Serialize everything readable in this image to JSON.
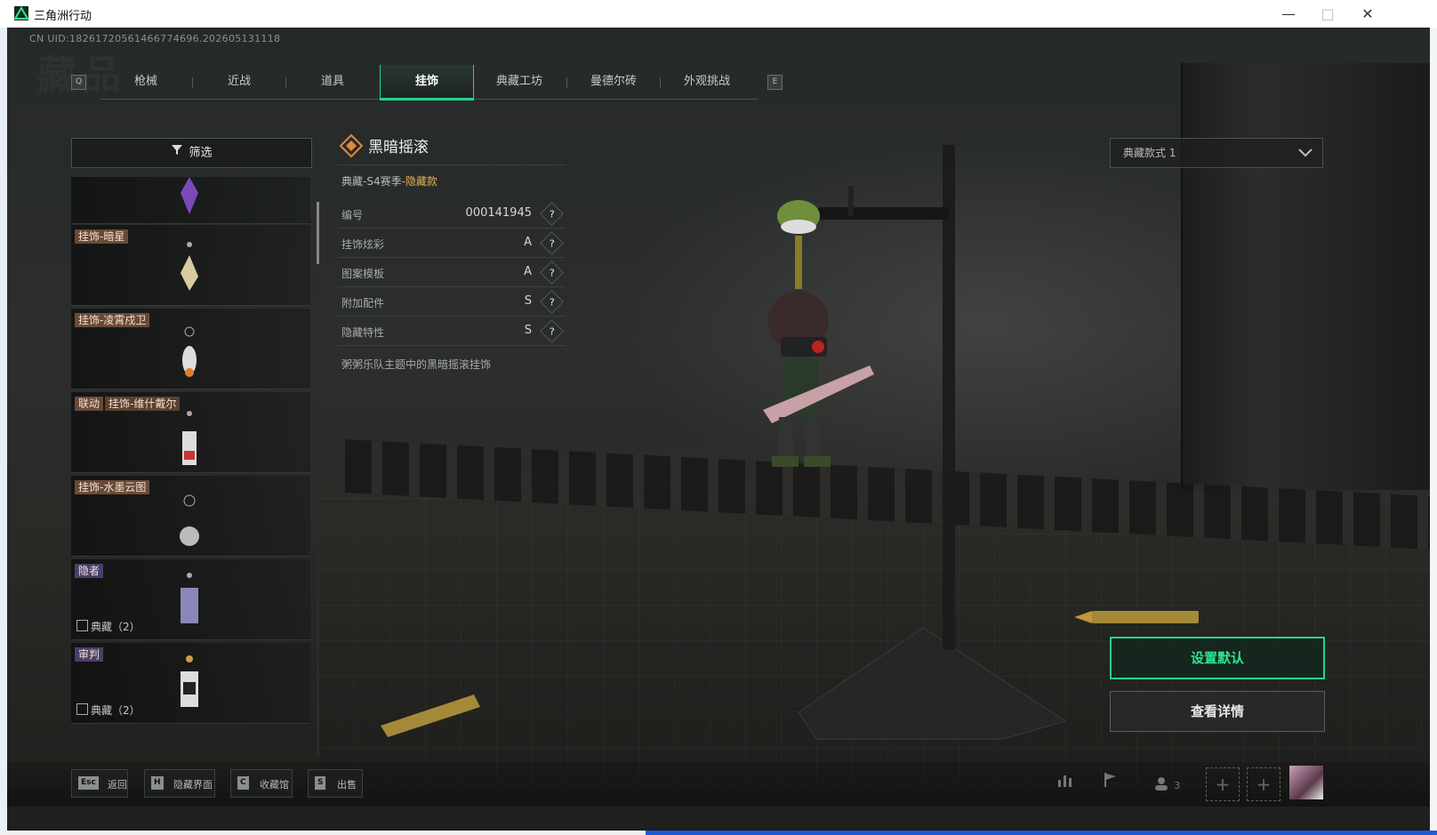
{
  "window": {
    "title": "三角洲行动",
    "minimize": "—",
    "maximize": "□",
    "close": "✕"
  },
  "header": {
    "uid": "CN UID:18261720561466774696.202605131118",
    "bg_title": "藏品"
  },
  "tabs": {
    "left_key": "Q",
    "right_key": "E",
    "items": [
      "枪械",
      "近战",
      "道具",
      "挂饰",
      "典藏工坊",
      "曼德尔砖",
      "外观挑战"
    ],
    "active_index": 3
  },
  "filter": {
    "label": "筛选"
  },
  "list": [
    {
      "tag": "",
      "subtitle": ""
    },
    {
      "tag": "挂饰-暗星",
      "subtitle": ""
    },
    {
      "tag": "挂饰-凌霄戍卫",
      "subtitle": ""
    },
    {
      "tag_prefix": "联动",
      "tag": "挂饰-维什戴尔",
      "subtitle": ""
    },
    {
      "tag": "挂饰-水墨云图",
      "subtitle": ""
    },
    {
      "tag": "隐者",
      "subtitle": "典藏（2）"
    },
    {
      "tag": "审判",
      "subtitle": "典藏（2）"
    }
  ],
  "detail": {
    "name": "黑暗摇滚",
    "rarity_prefix": "典藏-S4赛季-",
    "rarity_highlight": "隐藏款",
    "rows": [
      {
        "label": "编号",
        "value": "000141945"
      },
      {
        "label": "挂饰炫彩",
        "value": "A"
      },
      {
        "label": "图案模板",
        "value": "A"
      },
      {
        "label": "附加配件",
        "value": "S"
      },
      {
        "label": "隐藏特性",
        "value": "S"
      }
    ],
    "help": "?",
    "description": "粥粥乐队主题中的黑暗摇滚挂饰"
  },
  "style_select": {
    "value": "典藏款式 1"
  },
  "actions": {
    "set_default": "设置默认",
    "view_detail": "查看详情"
  },
  "bottom": {
    "shortcuts": [
      {
        "key": "Esc",
        "label": "返回"
      },
      {
        "key": "H",
        "label": "隐藏界面"
      },
      {
        "key": "C",
        "label": "收藏馆"
      },
      {
        "key": "S",
        "label": "出售"
      }
    ],
    "party_count": "3"
  },
  "colors": {
    "accent": "#1fd78a",
    "rarity": "#e0b24c"
  }
}
